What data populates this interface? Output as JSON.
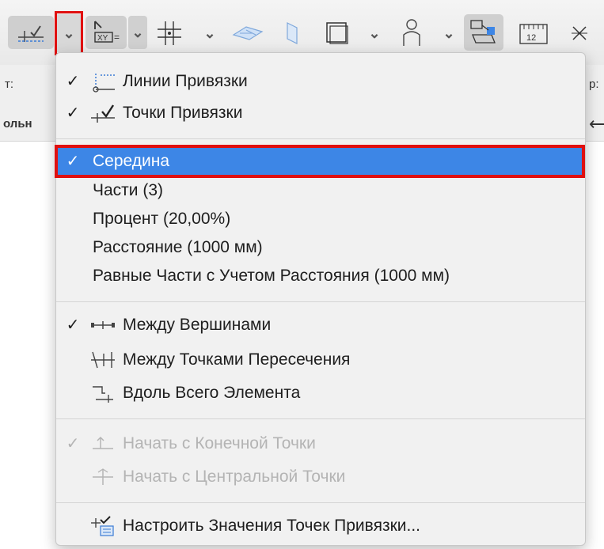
{
  "toolbar": {
    "items": [
      {
        "name": "snap-guide-lines-icon"
      },
      {
        "name": "chevron-down-icon"
      },
      {
        "name": "coordinates-xy-icon",
        "label": "XY"
      },
      {
        "name": "grid-snap-icon"
      },
      {
        "name": "plane-icon"
      },
      {
        "name": "surface-icon"
      },
      {
        "name": "box-frame-icon"
      },
      {
        "name": "person-icon"
      },
      {
        "name": "teamwork-icon"
      },
      {
        "name": "ruler-icon",
        "label": "12"
      },
      {
        "name": "cross-icon"
      }
    ]
  },
  "infobar": {
    "left_label": "т:",
    "left_text": "ольн",
    "right_label": "р:"
  },
  "menu": {
    "items": [
      {
        "check": "✓",
        "label": "Линии Привязки",
        "icon": "snap-lines-icon"
      },
      {
        "check": "✓",
        "label": "Точки Привязки",
        "icon": "snap-points-icon"
      },
      {
        "check": "✓",
        "label": "Середина",
        "selected": true
      },
      {
        "check": "",
        "label": "Части (3)"
      },
      {
        "check": "",
        "label": "Процент (20,00%)"
      },
      {
        "check": "",
        "label": "Расстояние (1000 мм)"
      },
      {
        "check": "",
        "label": "Равные Части с Учетом Расстояния (1000 мм)"
      },
      {
        "check": "✓",
        "label": "Между Вершинами",
        "icon": "between-vertices-icon"
      },
      {
        "check": "",
        "label": "Между Точками Пересечения",
        "icon": "between-intersections-icon"
      },
      {
        "check": "",
        "label": "Вдоль Всего Элемента",
        "icon": "along-element-icon"
      },
      {
        "check": "✓",
        "label": "Начать с Конечной Точки",
        "icon": "start-endpoint-icon",
        "disabled": true
      },
      {
        "check": "",
        "label": "Начать с Центральной Точки",
        "icon": "start-center-icon",
        "disabled": true
      },
      {
        "check": "",
        "label": "Настроить Значения Точек Привязки...",
        "icon": "snap-settings-icon"
      }
    ]
  },
  "colors": {
    "selection": "#3d86e6",
    "highlight_frame": "#e01010",
    "disabled_text": "#b4b4b4"
  }
}
